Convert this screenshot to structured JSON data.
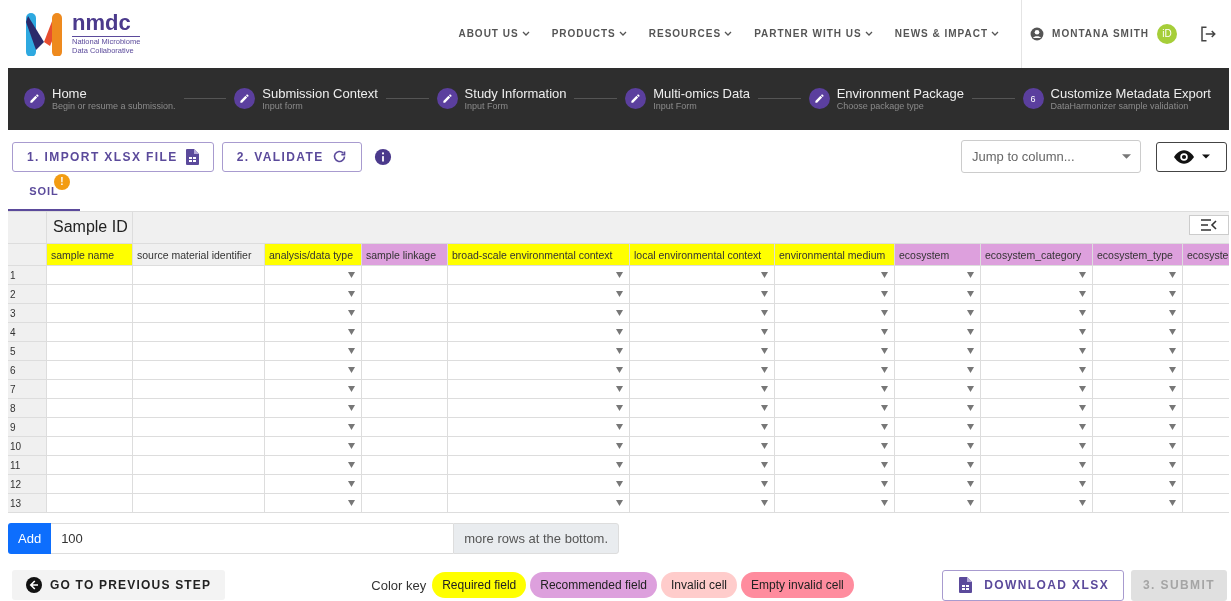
{
  "brand": {
    "name": "nmdc",
    "tagline_1": "National Microbiome",
    "tagline_2": "Data Collaborative"
  },
  "nav": [
    {
      "label": "ABOUT US"
    },
    {
      "label": "PRODUCTS"
    },
    {
      "label": "RESOURCES"
    },
    {
      "label": "PARTNER WITH US"
    },
    {
      "label": "NEWS & IMPACT"
    }
  ],
  "user": {
    "name": "MONTANA SMITH",
    "orcid": "iD"
  },
  "steps": [
    {
      "title": "Home",
      "subtitle": "Begin or resume a submission.",
      "done": true
    },
    {
      "title": "Submission Context",
      "subtitle": "Input form",
      "done": true
    },
    {
      "title": "Study Information",
      "subtitle": "Input Form",
      "done": true
    },
    {
      "title": "Multi-omics Data",
      "subtitle": "Input Form",
      "done": true
    },
    {
      "title": "Environment Package",
      "subtitle": "Choose package type",
      "done": true
    },
    {
      "title": "Customize Metadata Export",
      "subtitle": "DataHarmonizer sample validation",
      "done": false,
      "number": "6"
    }
  ],
  "toolbar": {
    "import": "1. IMPORT XLSX FILE",
    "validate": "2. VALIDATE",
    "jump": {
      "placeholder": "Jump to column..."
    }
  },
  "tabs": [
    {
      "label": "SOIL",
      "selected": true,
      "badge": "!"
    }
  ],
  "table": {
    "group": "Sample ID",
    "columns": [
      {
        "label": "sample name",
        "kind": "required",
        "dropdown": false
      },
      {
        "label": "source material identifier",
        "kind": "plain",
        "dropdown": false
      },
      {
        "label": "analysis/data type",
        "kind": "required",
        "dropdown": true
      },
      {
        "label": "sample linkage",
        "kind": "recommended",
        "dropdown": false
      },
      {
        "label": "broad-scale environmental context",
        "kind": "required",
        "dropdown": true
      },
      {
        "label": "local environmental context",
        "kind": "required",
        "dropdown": true
      },
      {
        "label": "environmental medium",
        "kind": "required",
        "dropdown": true
      },
      {
        "label": "ecosystem",
        "kind": "recommended",
        "dropdown": true
      },
      {
        "label": "ecosystem_category",
        "kind": "recommended",
        "dropdown": true
      },
      {
        "label": "ecosystem_type",
        "kind": "recommended",
        "dropdown": true
      },
      {
        "label": "ecosyste",
        "kind": "recommended"
      }
    ],
    "rows": [
      "1",
      "2",
      "3",
      "4",
      "5",
      "6",
      "7",
      "8",
      "9",
      "10",
      "11",
      "12",
      "13"
    ]
  },
  "add_rows": {
    "button": "Add",
    "value": "100",
    "suffix": "more rows at the bottom."
  },
  "footer": {
    "back": "GO TO PREVIOUS STEP",
    "color_key": "Color key",
    "legend": [
      {
        "label": "Required field",
        "color": "#ffff00"
      },
      {
        "label": "Recommended field",
        "color": "#dda0dd"
      },
      {
        "label": "Invalid cell",
        "color": "#ffcccb"
      },
      {
        "label": "Empty invalid cell",
        "color": "#ff8c9e"
      }
    ],
    "download": "DOWNLOAD XLSX",
    "submit": "3. SUBMIT",
    "submit_disabled": true
  }
}
